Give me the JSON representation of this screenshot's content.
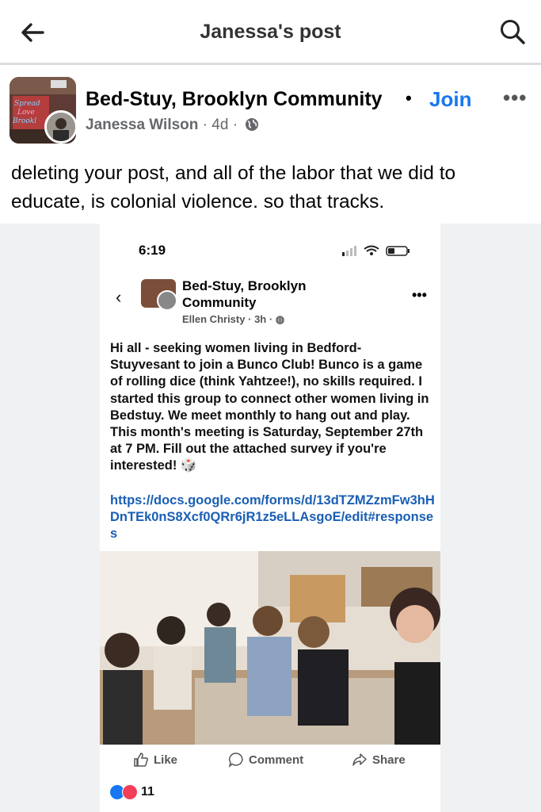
{
  "header": {
    "title": "Janessa's post",
    "back_icon": "back-arrow-icon",
    "search_icon": "search-icon"
  },
  "post": {
    "group_name": "Bed-Stuy, Brooklyn Community",
    "separator": "•",
    "join_label": "Join",
    "more_label": "•••",
    "author": "Janessa Wilson",
    "time": "4d",
    "meta_sep": "·",
    "privacy_icon": "globe-icon",
    "avatar_sign_text": "Spread Love it's Brooklyn",
    "text": "deleting your post, and all of the labor that we did to educate, is colonial violence. so that tracks."
  },
  "screenshot": {
    "status_time": "6:19",
    "back_label": "‹",
    "group_name": "Bed-Stuy, Brooklyn Community",
    "author": "Ellen Christy",
    "time": "3h",
    "meta_sep": "·",
    "more_label": "•••",
    "text": "Hi all - seeking women living in Bedford-Stuyvesant to join a Bunco Club! Bunco is a game of rolling dice (think Yahtzee!), no skills required. I started this group to connect other women living in Bedstuy. We meet monthly to hang out and play. This month's meeting is Saturday, September 27th at 7 PM. Fill out the attached survey if you're interested! 🎲",
    "link": "https://docs.google.com/forms/d/13dTZMZzmFw3hHDnTEk0nS8Xcf0QRr6jR1z5eLLAsgoE/edit#responses",
    "actions": {
      "like": "Like",
      "comment": "Comment",
      "share": "Share"
    },
    "reaction_count": "11"
  },
  "colors": {
    "accent": "#1877f2",
    "link": "#1a5fb4",
    "meta": "#65676b"
  }
}
